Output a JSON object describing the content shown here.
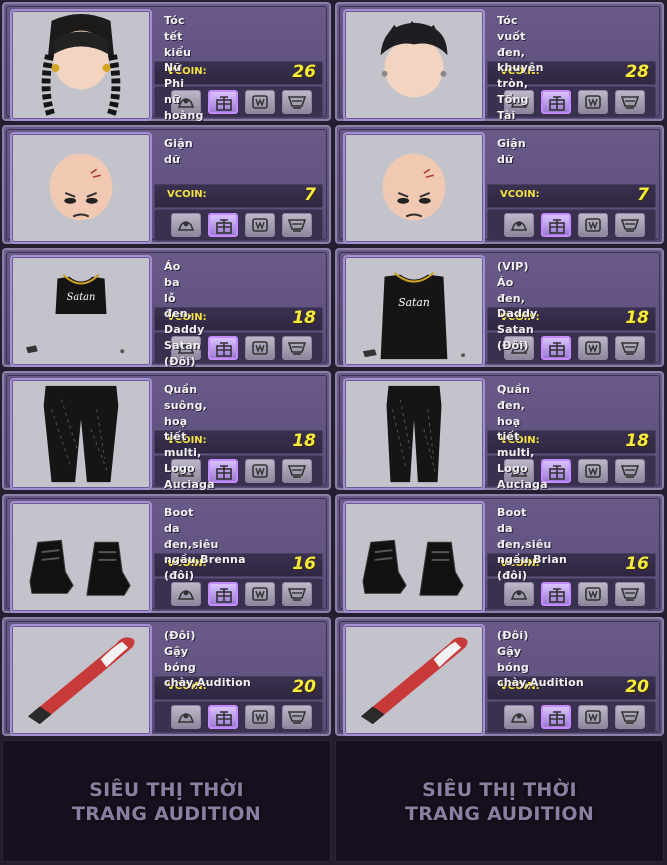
{
  "items": [
    {
      "name": "Tóc tết kiểu Nữ Phi nữ hoàng",
      "price": "26",
      "icon": "braid-hair-head"
    },
    {
      "name": "Tóc vuốt đen, khuyên tròn, Tổng Tài",
      "price": "28",
      "icon": "spiky-hair-head"
    },
    {
      "name": "Giận dữ",
      "price": "7",
      "icon": "angry-face-head"
    },
    {
      "name": "Giận dữ",
      "price": "7",
      "icon": "angry-face-head"
    },
    {
      "name": "Áo ba lỗ đen, Daddy Satan (Đôi)",
      "price": "18",
      "icon": "crop-tank-top"
    },
    {
      "name": "(VIP) Áo đen, Daddy Satan (Đôi)",
      "price": "18",
      "icon": "tank-top-cape"
    },
    {
      "name": "Quần suông, hoạ tiết multi, Logo Auciaga",
      "price": "18",
      "icon": "wide-pants"
    },
    {
      "name": "Quần đen, hoạ tiết multi, Logo Auciaga",
      "price": "18",
      "icon": "black-pants"
    },
    {
      "name": "Boot da đen,siêu ngầu,Brenna (đôi)",
      "price": "16",
      "icon": "black-boots"
    },
    {
      "name": "Boot da đen,siêu ngầu,Brian (đôi)",
      "price": "16",
      "icon": "black-boots"
    },
    {
      "name": "(Đôi) Gậy bóng chày,Audition",
      "price": "20",
      "icon": "baseball-bat"
    },
    {
      "name": "(Đôi) Gậy bóng chày,Audition",
      "price": "20",
      "icon": "baseball-bat"
    }
  ],
  "price_label": "VCOIN:",
  "buttons": [
    "try-on-icon",
    "gift-icon",
    "wardrobe-icon",
    "cart-icon"
  ],
  "banner": {
    "line1": "SIÊU THỊ THỜI",
    "line2": "TRANG AUDITION"
  }
}
